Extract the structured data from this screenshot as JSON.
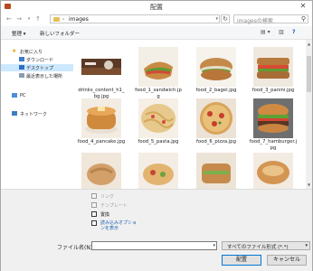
{
  "window": {
    "title": "配置"
  },
  "address": {
    "folder": "images",
    "search_placeholder": "imagesの検索"
  },
  "toolbar": {
    "organize": "整理 ▾",
    "new_folder": "新しいフォルダー"
  },
  "nav": [
    {
      "label": "お気に入り"
    },
    {
      "label": "ダウンロード"
    },
    {
      "label": "デスクトップ"
    },
    {
      "label": "最近表示した場所"
    },
    {
      "label": "PC"
    },
    {
      "label": "ネットワーク"
    }
  ],
  "files": [
    {
      "name": "drinks_content_h1_bg.jpg"
    },
    {
      "name": "food_1_sandwich.jpg"
    },
    {
      "name": "food_2_bagel.jpg"
    },
    {
      "name": "food_3_panini.jpg"
    },
    {
      "name": "food_4_pancake.jpg"
    },
    {
      "name": "food_5_pasta.jpg"
    },
    {
      "name": "food_6_pizza.jpg"
    },
    {
      "name": "food_7_hamburger.jpg"
    },
    {
      "name": ""
    },
    {
      "name": ""
    },
    {
      "name": ""
    },
    {
      "name": ""
    }
  ],
  "options": {
    "link": "リンク",
    "template": "テンプレート",
    "replace": "置換",
    "show_import_options": "読み込みオプションを表示"
  },
  "filename": {
    "label": "ファイル名(N):",
    "value": ""
  },
  "filetype": {
    "selected": "すべてのファイル形式 (*.*)"
  },
  "buttons": {
    "place": "配置",
    "cancel": "キャンセル"
  }
}
